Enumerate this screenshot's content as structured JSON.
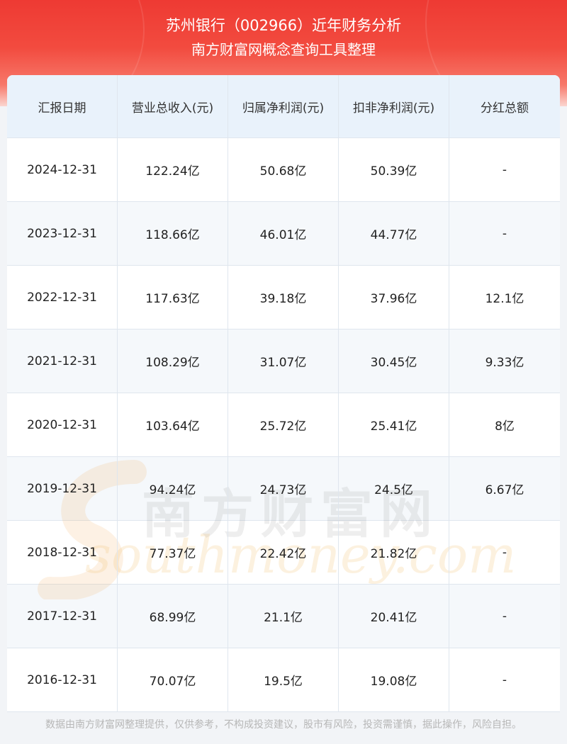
{
  "header": {
    "title": "苏州银行（002966）近年财务分析",
    "subtitle": "南方财富网概念查询工具整理"
  },
  "table": {
    "columns": [
      "汇报日期",
      "营业总收入(元)",
      "归属净利润(元)",
      "扣非净利润(元)",
      "分红总额"
    ],
    "rows": [
      [
        "2024-12-31",
        "122.24亿",
        "50.68亿",
        "50.39亿",
        "-"
      ],
      [
        "2023-12-31",
        "118.66亿",
        "46.01亿",
        "44.77亿",
        "-"
      ],
      [
        "2022-12-31",
        "117.63亿",
        "39.18亿",
        "37.96亿",
        "12.1亿"
      ],
      [
        "2021-12-31",
        "108.29亿",
        "31.07亿",
        "30.45亿",
        "9.33亿"
      ],
      [
        "2020-12-31",
        "103.64亿",
        "25.72亿",
        "25.41亿",
        "8亿"
      ],
      [
        "2019-12-31",
        "94.24亿",
        "24.73亿",
        "24.5亿",
        "6.67亿"
      ],
      [
        "2018-12-31",
        "77.37亿",
        "22.42亿",
        "21.82亿",
        "-"
      ],
      [
        "2017-12-31",
        "68.99亿",
        "21.1亿",
        "20.41亿",
        "-"
      ],
      [
        "2016-12-31",
        "70.07亿",
        "19.5亿",
        "19.08亿",
        "-"
      ]
    ]
  },
  "watermark": {
    "cn": "南方财富网",
    "en": "southmoney.com"
  },
  "footer": {
    "disclaimer": "数据由南方财富网整理提供，仅供参考，不构成投资建议，股市有风险，投资需谨慎，据此操作，风险自担。"
  },
  "colors": {
    "header_red": "#ee3a33",
    "header_row_bg": "#e9f2fb",
    "stripe_bg": "#f5f8fb",
    "grid_line": "#dfe6ee"
  }
}
